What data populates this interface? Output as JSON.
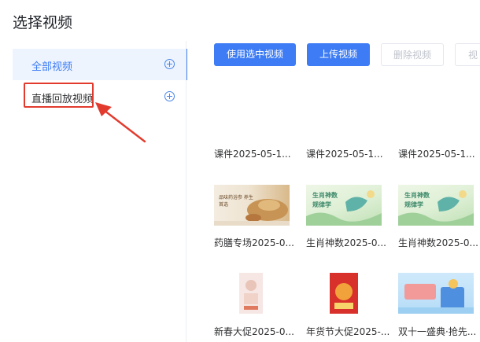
{
  "page": {
    "title": "选择视频"
  },
  "sidebar": {
    "items": [
      {
        "label": "全部视频",
        "active": true
      },
      {
        "label": "直播回放视频",
        "active": false
      }
    ]
  },
  "toolbar": {
    "use_selected": "使用选中视频",
    "upload": "上传视频",
    "delete": "删除视频",
    "more": "视"
  },
  "videos": [
    {
      "caption": "课件2025-05-1..."
    },
    {
      "caption": "课件2025-05-1..."
    },
    {
      "caption": "课件2025-05-1..."
    },
    {
      "caption": "药膳专场2025-0...",
      "thumb_text": "品味药浴参 养生首选"
    },
    {
      "caption": "生肖神数2025-0...",
      "thumb_text": "生肖神数 规律学"
    },
    {
      "caption": "生肖神数2025-0...",
      "thumb_text": "生肖神数 规律学"
    },
    {
      "caption": "新春大促2025-0..."
    },
    {
      "caption": "年货节大促2025-..."
    },
    {
      "caption": "双十一盛典·抢先..."
    }
  ],
  "colors": {
    "primary": "#3d7cf4",
    "highlight_red": "#e23b2e"
  }
}
